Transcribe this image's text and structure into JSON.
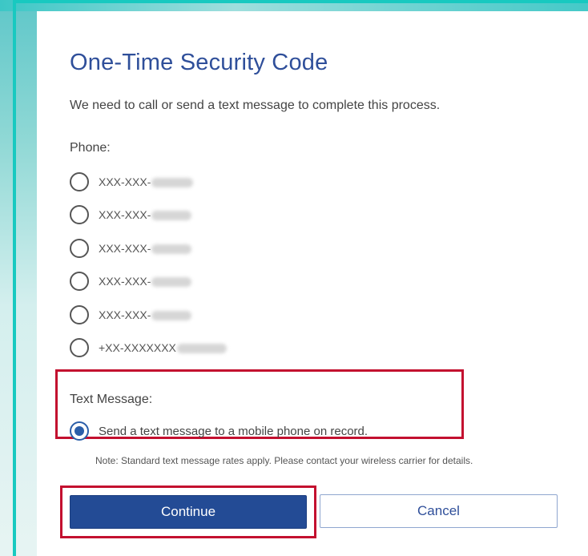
{
  "dialog": {
    "title": "One-Time Security Code",
    "intro": "We need to call or send a text message to complete this process.",
    "phone_label": "Phone:",
    "phone_options": [
      {
        "text": "XXX-XXX-",
        "selected": false
      },
      {
        "text": "XXX-XXX-",
        "selected": false
      },
      {
        "text": "XXX-XXX-",
        "selected": false
      },
      {
        "text": "XXX-XXX-",
        "selected": false
      },
      {
        "text": "XXX-XXX-",
        "selected": false
      },
      {
        "text": "+XX-XXXXXXX",
        "selected": false
      }
    ],
    "text_message_label": "Text Message:",
    "text_option": {
      "text": "Send a text message to a mobile phone on record.",
      "selected": true
    },
    "note": "Note: Standard text message rates apply. Please contact your wireless carrier for details.",
    "continue_label": "Continue",
    "cancel_label": "Cancel"
  },
  "colors": {
    "title": "#2f4f9a",
    "primary_button": "#234b95",
    "highlight": "#c3102f",
    "frame_accent": "#18c9c0"
  }
}
